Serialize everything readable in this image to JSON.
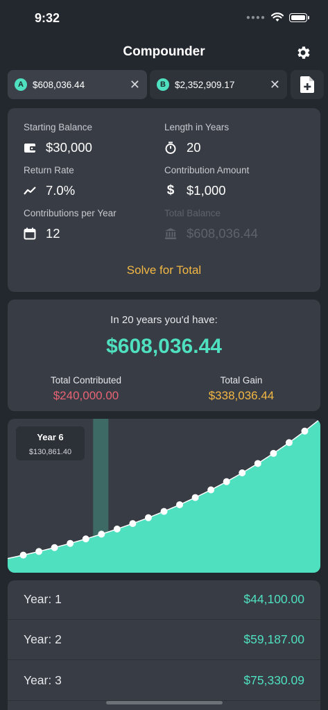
{
  "status": {
    "time": "9:32"
  },
  "nav": {
    "title": "Compounder"
  },
  "tabs": [
    {
      "badge": "A",
      "amount": "$608,036.44",
      "close": "✕"
    },
    {
      "badge": "B",
      "amount": "$2,352,909.17",
      "close": "✕"
    }
  ],
  "inputs": {
    "starting_balance": {
      "label": "Starting Balance",
      "value": "$30,000",
      "icon": "wallet-icon"
    },
    "length_years": {
      "label": "Length in Years",
      "value": "20",
      "icon": "stopwatch-icon"
    },
    "return_rate": {
      "label": "Return Rate",
      "value": "7.0%",
      "icon": "trending-up-icon"
    },
    "contribution_amount": {
      "label": "Contribution Amount",
      "value": "$1,000",
      "icon": "dollar-icon"
    },
    "contributions_per_year": {
      "label": "Contributions per Year",
      "value": "12",
      "icon": "calendar-icon"
    },
    "total_balance": {
      "label": "Total Balance",
      "value": "$608,036.44",
      "icon": "bank-icon"
    },
    "solve_label": "Solve for Total"
  },
  "result": {
    "headline": "In 20 years you'd have:",
    "total": "$608,036.44",
    "contributed_label": "Total Contributed",
    "contributed_value": "$240,000.00",
    "gain_label": "Total Gain",
    "gain_value": "$338,036.44"
  },
  "chart_tooltip": {
    "title": "Year 6",
    "value": "$130,861.40"
  },
  "chart_data": {
    "type": "area",
    "x": [
      0,
      1,
      2,
      3,
      4,
      5,
      6,
      7,
      8,
      9,
      10,
      11,
      12,
      13,
      14,
      15,
      16,
      17,
      18,
      19,
      20
    ],
    "values": [
      30000,
      44100,
      59187,
      75330.09,
      92603.2,
      111085.42,
      130861.4,
      152021.7,
      174663.22,
      198889.65,
      224811.92,
      252548.76,
      282227.17,
      313983.13,
      347962.04,
      384319.39,
      423221.02,
      464845.04,
      509381.32,
      557033.9,
      608036.44
    ],
    "highlight_index": 6,
    "colors": {
      "fill": "#4fe0c0",
      "marker": "#ffffff",
      "highlight": "#3e6a66"
    }
  },
  "table": [
    {
      "year": "Year: 1",
      "value": "$44,100.00"
    },
    {
      "year": "Year: 2",
      "value": "$59,187.00"
    },
    {
      "year": "Year: 3",
      "value": "$75,330.09"
    }
  ],
  "colors": {
    "accent": "#4fe0c0",
    "warning": "#f4b844",
    "negative": "#e86374",
    "background": "#23272e",
    "card": "#383c44"
  }
}
